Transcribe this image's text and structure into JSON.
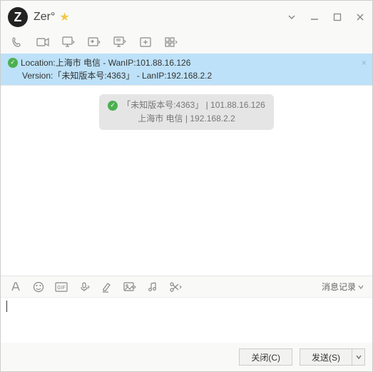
{
  "titlebar": {
    "avatar_letter": "Z",
    "contact_name": "Zer°"
  },
  "notification": {
    "location_label": "Location:",
    "location_value": "上海市 电信",
    "wanip_label": " - WanIP:",
    "wanip_value": "101.88.16.126",
    "version_label": "Version:",
    "version_value": "「未知版本号:4363」",
    "lanip_label": "  - LanIP:",
    "lanip_value": "192.168.2.2"
  },
  "message": {
    "line1_part1": "「未知版本号:4363」",
    "line1_sep": " | ",
    "line1_part2": "101.88.16.126",
    "line2_part1": "上海市 电信",
    "line2_sep": " | ",
    "line2_part2": "192.168.2.2"
  },
  "editor": {
    "history_label": "消息记录"
  },
  "buttons": {
    "close": "关闭(C)",
    "send": "发送(S)"
  }
}
